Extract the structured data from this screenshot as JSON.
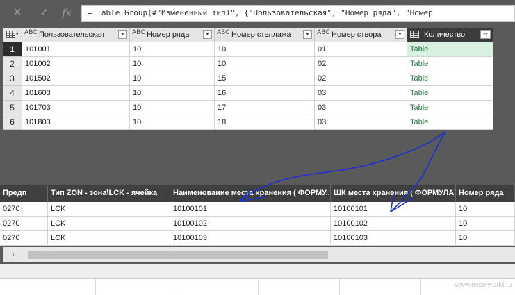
{
  "formula_bar": {
    "cancel_icon": "x-icon",
    "confirm_icon": "check-icon",
    "fx_label": "fx",
    "formula": "= Table.Group(#\"Измененный тип1\", {\"Пользовательская\", \"Номер ряда\", \"Номер"
  },
  "query_table": {
    "corner_icon": "table-grid-icon",
    "type_badge": "ABC",
    "columns": [
      {
        "label": "Пользовательская"
      },
      {
        "label": "Номер ряда"
      },
      {
        "label": "Номер стеллажа"
      },
      {
        "label": "Номер створа"
      },
      {
        "label": "Количество"
      }
    ],
    "rows": [
      {
        "num": "1",
        "cells": [
          "101001",
          "10",
          "10",
          "01",
          "Table"
        ]
      },
      {
        "num": "2",
        "cells": [
          "101002",
          "10",
          "10",
          "02",
          "Table"
        ]
      },
      {
        "num": "3",
        "cells": [
          "101502",
          "10",
          "15",
          "02",
          "Table"
        ]
      },
      {
        "num": "4",
        "cells": [
          "101603",
          "10",
          "16",
          "03",
          "Table"
        ]
      },
      {
        "num": "5",
        "cells": [
          "101703",
          "10",
          "17",
          "03",
          "Table"
        ]
      },
      {
        "num": "6",
        "cells": [
          "101803",
          "10",
          "18",
          "03",
          "Table"
        ]
      }
    ]
  },
  "sheet": {
    "headers": [
      "Предп",
      "Тип ZON - зона\\LCK - ячейка",
      "Наименование места хранения ( ФОРМУ...",
      "ШК места хранения ( ФОРМУЛА)",
      "Номер ряда"
    ],
    "rows": [
      [
        "0270",
        "LCK",
        "10100101",
        "10100101",
        "10"
      ],
      [
        "0270",
        "LCK",
        "10100102",
        "10100102",
        "10"
      ],
      [
        "0270",
        "LCK",
        "10100103",
        "10100103",
        "10"
      ]
    ]
  },
  "scrollbar": {
    "left_arrow": "‹"
  },
  "watermark": "www.excelworld.ru",
  "colors": {
    "accent_table": "#1f7a3f",
    "selected_header": "#3b3b3b",
    "annotation": "#1a2fd6"
  }
}
